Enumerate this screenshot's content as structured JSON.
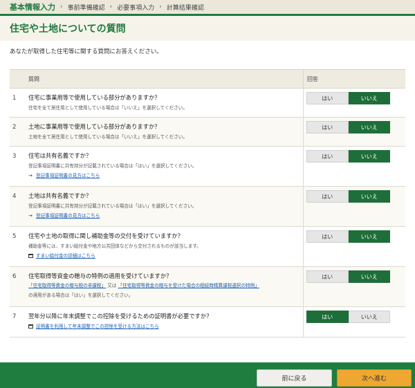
{
  "breadcrumb": {
    "current": "基本情報入力",
    "steps": [
      "事前準備確認",
      "必要事項入力",
      "計算結果確認"
    ]
  },
  "page_title": "住宅や土地についての質問",
  "intro": "あなたが取得した住宅等に関する質問にお答えください。",
  "table": {
    "header_question": "質問",
    "header_answer": "回答"
  },
  "questions": [
    {
      "num": "1",
      "text": "住宅に事業用等で使用している部分がありますか？",
      "note": "住宅を全て居住用として使用している場合は「いいえ」を選択してください。",
      "yes": "はい",
      "no": "いいえ",
      "selected": "no"
    },
    {
      "num": "2",
      "text": "土地に事業用等で使用している部分がありますか？",
      "note": "土地を全て居住用として使用している場合は「いいえ」を選択してください。",
      "yes": "はい",
      "no": "いいえ",
      "selected": "no"
    },
    {
      "num": "3",
      "text": "住宅は共有名義ですか？",
      "note": "登記事項証明書に共有持分が記載されている場合は「はい」を選択してください。",
      "link": "登記事項証明書の見方はこちら",
      "yes": "はい",
      "no": "いいえ",
      "selected": "no"
    },
    {
      "num": "4",
      "text": "土地は共有名義ですか？",
      "note": "登記事項証明書に共有持分が記載されている場合は「はい」を選択してください。",
      "link": "登記事項証明書の見方はこちら",
      "yes": "はい",
      "no": "いいえ",
      "selected": "no"
    },
    {
      "num": "5",
      "text": "住宅や土地の取得に関し補助金等の交付を受けていますか？",
      "note": "補助金等には、すまい給付金や地方公共団体などから交付されるものが該当します。",
      "link": "すまい給付金の詳細はこちら",
      "yes": "はい",
      "no": "いいえ",
      "selected": "no"
    },
    {
      "num": "6",
      "text": "住宅取得等資金の贈与の特例の適用を受けていますか？",
      "link_a": "「住宅取得等資金の贈与税の非課税」",
      "mid": "又は",
      "link_b": "「住宅取得等資金の贈与を受けた場合の相続時精算課税選択の特例」",
      "note": "の適用がある場合は「はい」を選択してください。",
      "yes": "はい",
      "no": "いいえ",
      "selected": "no"
    },
    {
      "num": "7",
      "text": "翌年分以降に年末調整でこの控除を受けるための証明書が必要ですか？",
      "link": "証明書を利用して年末調整でこの控除を受ける方法はこちら",
      "yes": "はい",
      "no": "いいえ",
      "selected": "yes"
    }
  ],
  "footer": {
    "back_label": "前に戻る",
    "next_label": "次へ進む"
  },
  "colors": {
    "brand_green": "#1f7a3f",
    "selected_green": "#1e6e3a",
    "next_orange": "#eea832"
  }
}
